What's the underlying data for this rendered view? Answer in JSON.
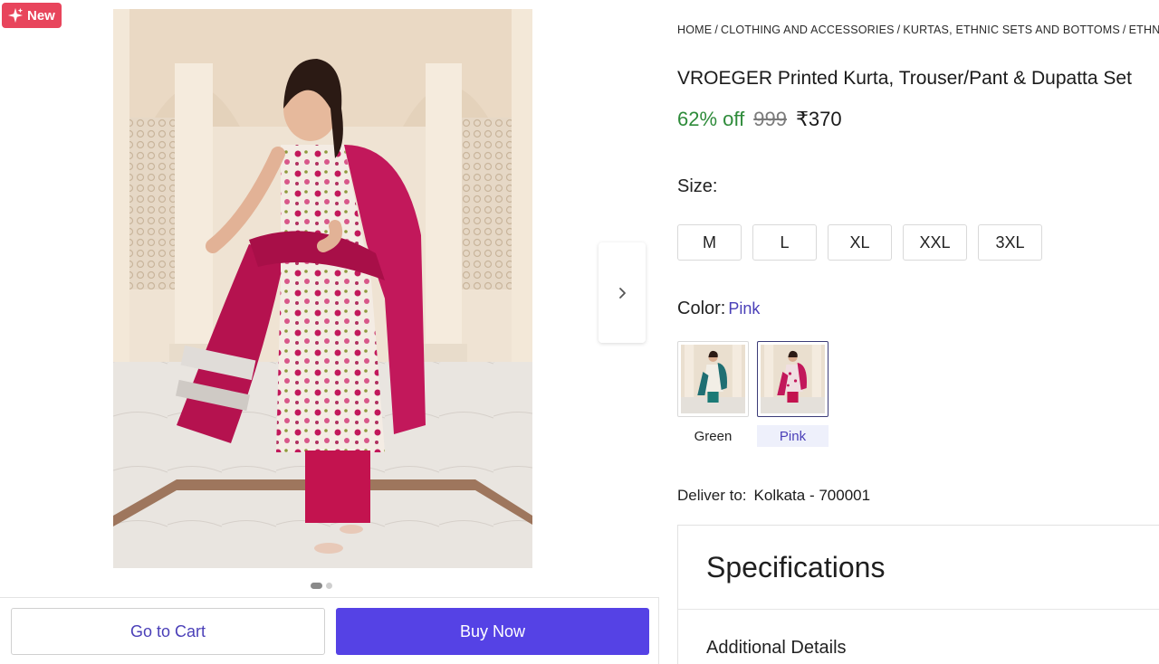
{
  "badge": {
    "label": "New",
    "color": "#e8455c"
  },
  "gallery": {
    "image_alt": "woman wearing pink printed kurta with pink dupatta",
    "next_icon": "chevron-right-icon",
    "slide_count": 2,
    "active_slide": 1
  },
  "actions": {
    "go_to_cart": "Go to Cart",
    "buy_now": "Buy Now",
    "buy_color": "#5542e5"
  },
  "breadcrumb": [
    "HOME",
    "CLOTHING AND ACCESSORIES",
    "KURTAS, ETHNIC SETS AND BOTTOMS",
    "ETHN"
  ],
  "product": {
    "title": "VROEGER Printed Kurta, Trouser/Pant & Dupatta Set",
    "discount": "62% off",
    "mrp": "999",
    "price": "₹370"
  },
  "size": {
    "label": "Size:",
    "options": [
      "M",
      "L",
      "XL",
      "XXL",
      "3XL"
    ]
  },
  "color": {
    "label": "Color:",
    "selected": "Pink",
    "options": [
      {
        "name": "Green",
        "selected": false
      },
      {
        "name": "Pink",
        "selected": true
      }
    ]
  },
  "delivery": {
    "label": "Deliver to:",
    "location": "Kolkata - 700001"
  },
  "specifications": {
    "title": "Specifications",
    "section": "Additional Details"
  }
}
